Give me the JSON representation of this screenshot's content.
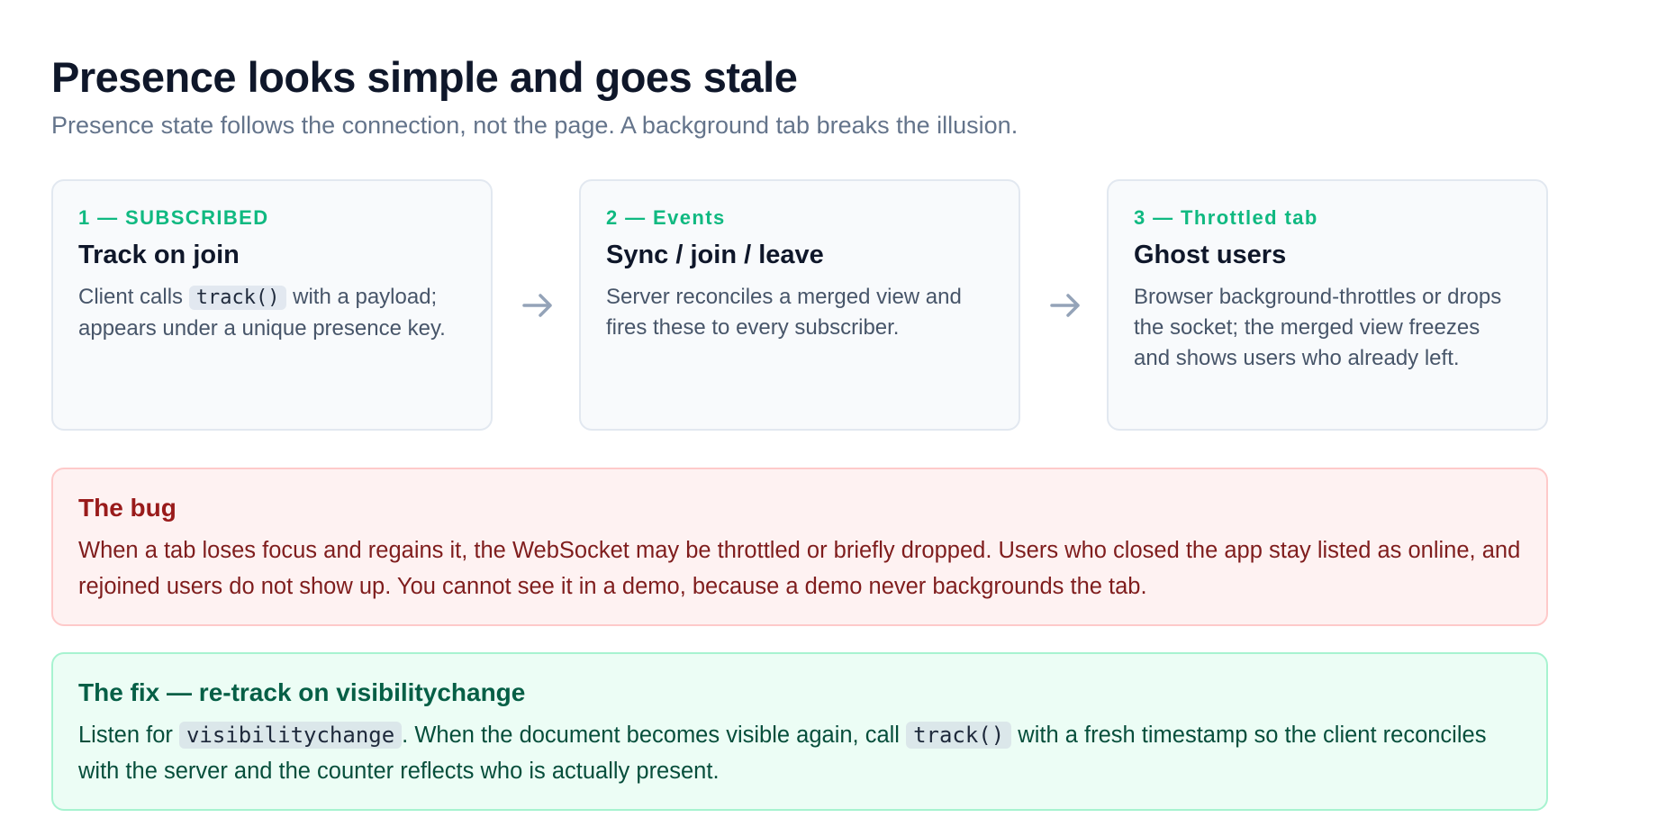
{
  "header": {
    "title": "Presence looks simple and goes stale",
    "subtitle": "Presence state follows the connection, not the page. A background tab breaks the illusion."
  },
  "steps": [
    {
      "kicker": "1 — SUBSCRIBED",
      "title": "Track on join",
      "body_before": "Client calls ",
      "code": "track()",
      "body_after": " with a payload; appears under a unique presence key."
    },
    {
      "kicker": "2 — Events",
      "title": "Sync / join / leave",
      "body": "Server reconciles a merged view and fires these to every subscriber."
    },
    {
      "kicker": "3 — Throttled tab",
      "title": "Ghost users",
      "body": "Browser background-throttles or drops the socket; the merged view freezes and shows users who already left."
    }
  ],
  "bug": {
    "title": "The bug",
    "body": "When a tab loses focus and regains it, the WebSocket may be throttled or briefly dropped. Users who closed the app stay listed as online, and rejoined users do not show up. You cannot see it in a demo, because a demo never backgrounds the tab."
  },
  "fix": {
    "title": "The fix — re-track on visibilitychange",
    "body_1": "Listen for ",
    "code_1": "visibilitychange",
    "body_2": ". When the document becomes visible again, call ",
    "code_2": "track()",
    "body_3": " with a fresh timestamp so the client reconciles with the server and the counter reflects who is actually present."
  },
  "icons": {
    "arrow": "arrow-right-icon"
  },
  "colors": {
    "accent": "#10b981",
    "bug_bg": "#fef2f2",
    "bug_text": "#991b1b",
    "fix_bg": "#ecfdf5",
    "fix_text": "#065f46"
  }
}
